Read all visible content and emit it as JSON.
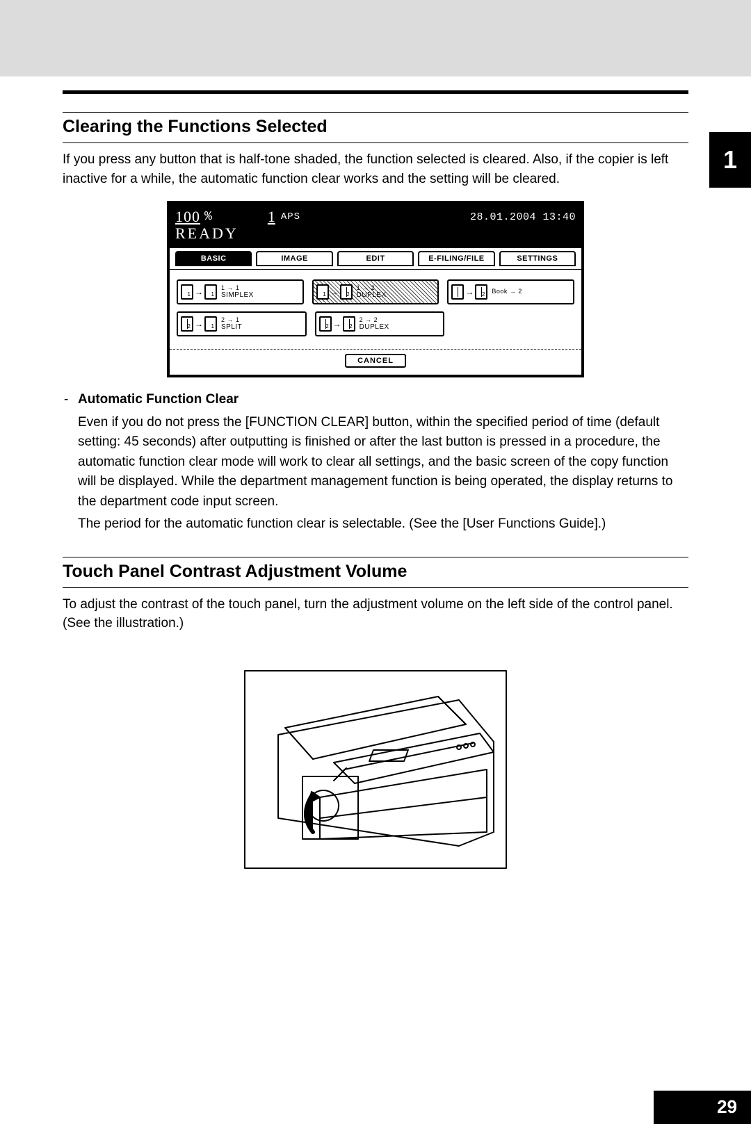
{
  "chapter_tab": "1",
  "page_number": "29",
  "section1": {
    "heading": "Clearing the Functions Selected",
    "paragraph": "If you press any button that is half-tone shaded, the function selected is cleared. Also, if the copier is left inactive for a while, the automatic function clear works and the setting will be cleared."
  },
  "screen": {
    "percent_value": "100",
    "percent_symbol": "%",
    "quantity": "1",
    "aps": "APS",
    "timestamp": "28.01.2004 13:40",
    "ready": "READY",
    "tabs": [
      "BASIC",
      "IMAGE",
      "EDIT",
      "E-FILING/FILE",
      "SETTINGS"
    ],
    "modes": {
      "simplex": {
        "line1": "1 → 1",
        "line2": "SIMPLEX"
      },
      "duplex12": {
        "line1": "1 → 2",
        "line2": "DUPLEX"
      },
      "book": {
        "line1": "Book → 2",
        "line2": ""
      },
      "split": {
        "line1": "2 → 1",
        "line2": "SPLIT"
      },
      "duplex22": {
        "line1": "2 → 2",
        "line2": "DUPLEX"
      }
    },
    "cancel": "CANCEL"
  },
  "afc": {
    "title": "Automatic Function Clear",
    "body1": "Even if you do not press the [FUNCTION CLEAR] button, within the specified period of time (default setting: 45 seconds) after outputting is finished or after the last button is pressed in a procedure, the automatic function clear mode will work to clear all settings, and the basic screen of the copy function will be displayed. While the department management function is being operated, the display returns to the department code input screen.",
    "body2": "The period for the automatic function clear is selectable. (See the [User Functions Guide].)"
  },
  "section2": {
    "heading": "Touch Panel Contrast Adjustment Volume",
    "paragraph": "To adjust the contrast of the touch panel, turn the adjustment volume on the left side of the control panel. (See the illustration.)"
  }
}
